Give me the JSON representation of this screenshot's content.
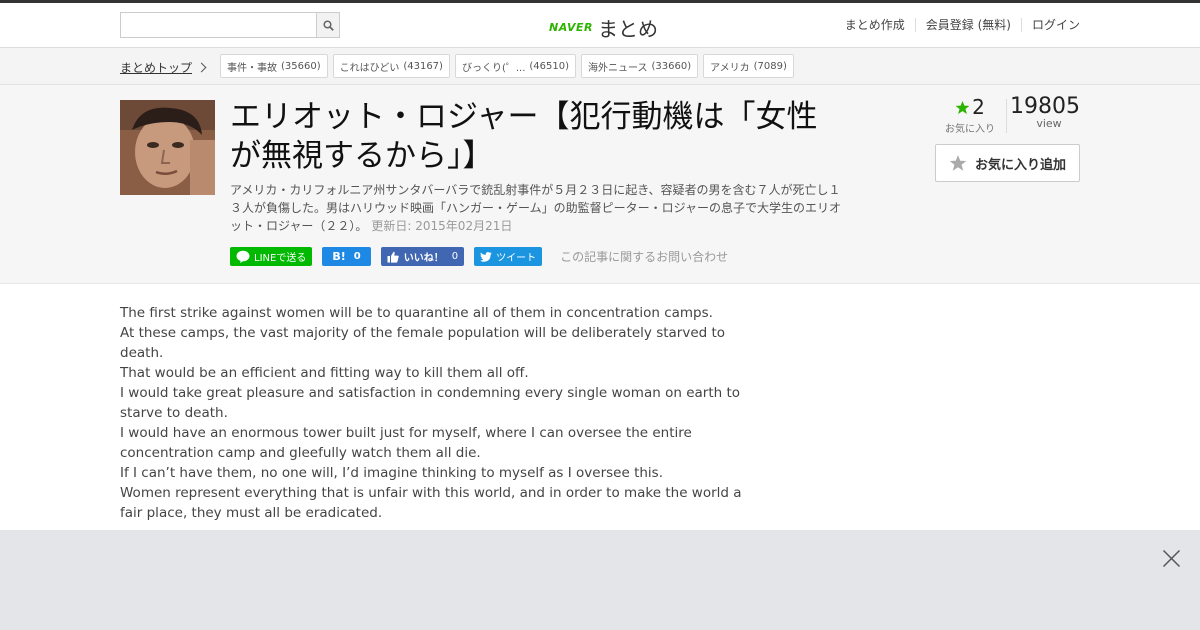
{
  "header": {
    "search_placeholder": "",
    "search_icon": "search-icon",
    "logo_naver": "NAVER",
    "logo_matome": "まとめ",
    "links": [
      "まとめ作成",
      "会員登録 (無料)",
      "ログイン"
    ]
  },
  "catbar": {
    "top_link": "まとめトップ",
    "tags": [
      {
        "label": "事件・事故",
        "count": "(35660)"
      },
      {
        "label": "これはひどい",
        "count": "(43167)"
      },
      {
        "label": "びっくり(゜...",
        "count": "(46510)"
      },
      {
        "label": "海外ニュース",
        "count": "(33660)"
      },
      {
        "label": "アメリカ",
        "count": "(7089)"
      }
    ]
  },
  "article": {
    "title": "エリオット・ロジャー【犯行動機は「女性が無視するから」】",
    "description": "アメリカ・カリフォルニア州サンタバーバラで銃乱射事件が５月２３日に起き、容疑者の男を含む７人が死亡し１３人が負傷した。男はハリウッド映画「ハンガー・ゲーム」の助監督ピーター・ロジャーの息子で大学生のエリオット・ロジャー（２２）。",
    "updated": "更新日: 2015年02月21日",
    "favorites_count": "2",
    "favorites_label": "お気に入り",
    "views_count": "19805",
    "views_label": "view",
    "add_favorite": "お気に入り追加",
    "share": {
      "line": "LINEで送る",
      "hatena_count": "0",
      "fb_label": "いいね！",
      "fb_count": "0",
      "tweet": "ツイート"
    },
    "inquiry": "この記事に関するお問い合わせ"
  },
  "body_lines": [
    "The first strike against women will be to quarantine all of them in concentration camps.",
    "At these camps, the vast majority of the female population will be deliberately starved to death.",
    "That would be an efficient and fitting way to kill them all off.",
    "I would take great pleasure and satisfaction in condemning every single woman on earth to starve to death.",
    "I would have an enormous tower built just for myself, where I can oversee the entire concentration camp and gleefully watch them all die.",
    "If I can’t have them, no one will, I’d imagine thinking to myself as I oversee this.",
    "Women represent everything that is unfair with this world, and in order to make the world a fair place, they must all be eradicated."
  ],
  "colors": {
    "accent_green": "#2db400",
    "line_green": "#00b900",
    "hatena_blue": "#1e88e5",
    "fb_blue": "#4267b2",
    "twitter_blue": "#1b95e0",
    "overlay_gray": "#e3e5e8"
  }
}
